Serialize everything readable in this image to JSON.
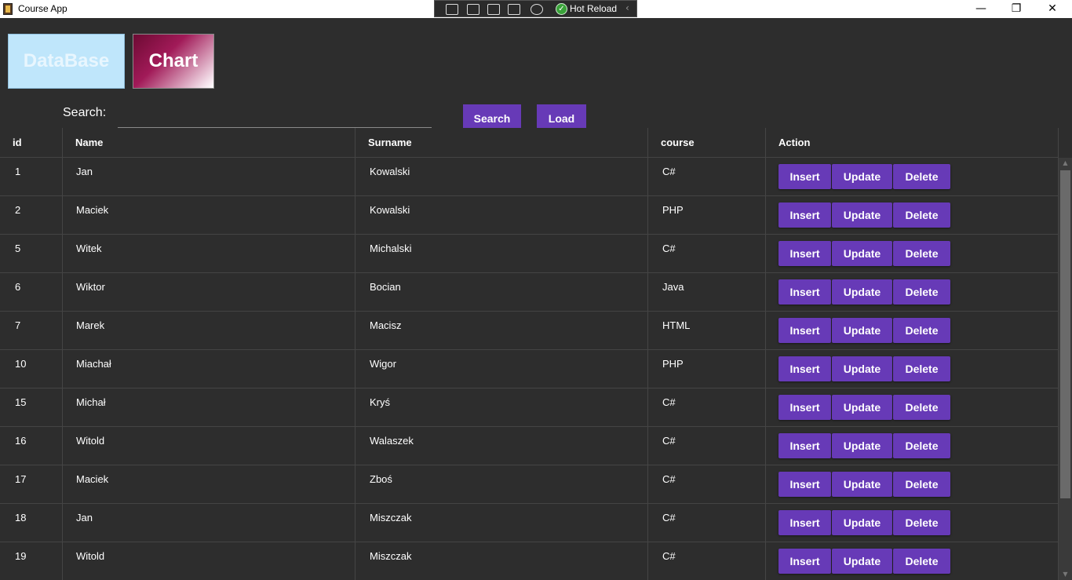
{
  "window": {
    "title": "Course App",
    "hot_reload_label": "Hot Reload",
    "controls": {
      "minimize": "—",
      "restore": "❐",
      "close": "✕"
    }
  },
  "nav": {
    "database_label": "DataBase",
    "chart_label": "Chart"
  },
  "search": {
    "label": "Search:",
    "value": "",
    "search_button": "Search",
    "load_button": "Load"
  },
  "table": {
    "headers": [
      "id",
      "Name",
      "Surname",
      "course",
      "Action"
    ],
    "rows": [
      {
        "id": "1",
        "name": "Jan",
        "surname": "Kowalski",
        "course": "C#"
      },
      {
        "id": "2",
        "name": "Maciek",
        "surname": "Kowalski",
        "course": "PHP"
      },
      {
        "id": "5",
        "name": "Witek",
        "surname": "Michalski",
        "course": "C#"
      },
      {
        "id": "6",
        "name": "Wiktor",
        "surname": "Bocian",
        "course": "Java"
      },
      {
        "id": "7",
        "name": "Marek",
        "surname": "Macisz",
        "course": "HTML"
      },
      {
        "id": "10",
        "name": "Miachał",
        "surname": "Wigor",
        "course": "PHP"
      },
      {
        "id": "15",
        "name": "Michał",
        "surname": "Kryś",
        "course": "C#"
      },
      {
        "id": "16",
        "name": "Witold",
        "surname": "Walaszek",
        "course": "C#"
      },
      {
        "id": "17",
        "name": "Maciek",
        "surname": "Zboś",
        "course": "C#"
      },
      {
        "id": "18",
        "name": "Jan",
        "surname": "Miszczak",
        "course": "C#"
      },
      {
        "id": "19",
        "name": "Witold",
        "surname": "Miszczak",
        "course": "C#"
      }
    ],
    "action_labels": {
      "insert": "Insert",
      "update": "Update",
      "delete": "Delete"
    }
  },
  "colors": {
    "background": "#2d2d2d",
    "accent": "#673ab7",
    "database_button": "#bfe6fb",
    "chart_button": "#a11a58",
    "hot_reload_ok": "#3aa33a"
  }
}
